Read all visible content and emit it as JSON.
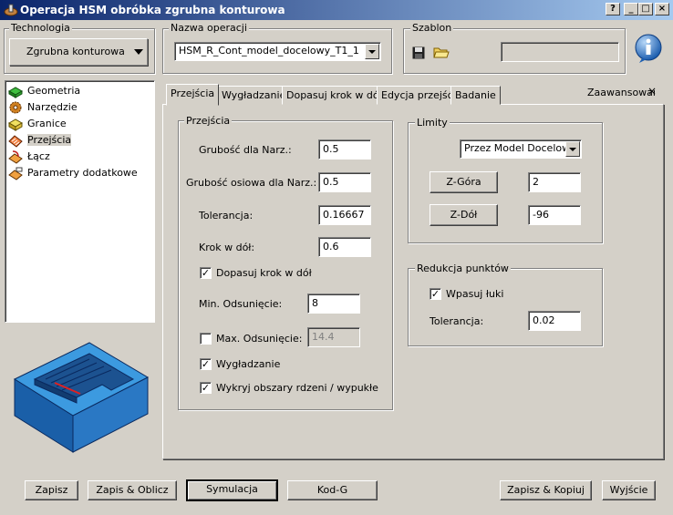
{
  "window": {
    "title": "Operacja HSM obróbka zgrubna konturowa",
    "controls": {
      "help": "?",
      "minimize": "_",
      "maximize": "□",
      "close": "×"
    }
  },
  "technologia": {
    "legend": "Technologia",
    "value": "Zgrubna konturowa"
  },
  "nazwa_operacji": {
    "legend": "Nazwa operacji",
    "value": "HSM_R_Cont_model_docelowy_T1_1"
  },
  "szablon": {
    "legend": "Szablon",
    "value": ""
  },
  "tree": {
    "items": [
      {
        "label": "Geometria",
        "icon": "geometry-icon"
      },
      {
        "label": "Narzędzie",
        "icon": "tool-icon"
      },
      {
        "label": "Granice",
        "icon": "boundary-icon"
      },
      {
        "label": "Przejścia",
        "icon": "passes-icon",
        "selected": true
      },
      {
        "label": "Łącz",
        "icon": "link-icon"
      },
      {
        "label": "Parametry dodatkowe",
        "icon": "parameters-icon"
      }
    ]
  },
  "tabs": {
    "items": [
      "Przejścia",
      "Wygładzanie",
      "Dopasuj krok w dół",
      "Edycja przejść",
      "Badanie"
    ],
    "active": 0,
    "advanced": "Zaawansowane"
  },
  "przejscia": {
    "legend": "Przejścia",
    "grubosc_label": "Grubość dla Narz.:",
    "grubosc_value": "0.5",
    "grubosc_osiowa_label": "Grubość osiowa dla Narz.:",
    "grubosc_osiowa_value": "0.5",
    "tolerancja_label": "Tolerancja:",
    "tolerancja_value": "0.16667",
    "krok_label": "Krok w dół:",
    "krok_value": "0.6",
    "dopasuj_label": "Dopasuj krok w dół",
    "dopasuj_checked": true,
    "min_odsuniecie_label": "Min. Odsunięcie:",
    "min_odsuniecie_value": "8",
    "max_odsuniecie_label": "Max. Odsunięcie:",
    "max_odsuniecie_value": "14.4",
    "max_odsuniecie_checked": false,
    "wygladzanie_label": "Wygładzanie",
    "wygladzanie_checked": true,
    "wykryj_label": "Wykryj obszary rdzeni / wypukłe",
    "wykryj_checked": true
  },
  "limity": {
    "legend": "Limity",
    "mode": "Przez Model Docelowy",
    "z_gora_label": "Z-Góra",
    "z_gora_value": "2",
    "z_dol_label": "Z-Dół",
    "z_dol_value": "-96"
  },
  "redukcja": {
    "legend": "Redukcja punktów",
    "wpasuj_label": "Wpasuj łuki",
    "wpasuj_checked": true,
    "tolerancja_label": "Tolerancja:",
    "tolerancja_value": "0.02"
  },
  "buttons": {
    "zapisz": "Zapisz",
    "zapis_oblicz": "Zapis & Oblicz",
    "symulacja": "Symulacja",
    "kod_g": "Kod-G",
    "zapisz_kopiuj": "Zapisz & Kopiuj",
    "wyjscie": "Wyjście"
  },
  "colors": {
    "titlebar": "#0a246a",
    "preview_blue": "#2f8fd0",
    "info_blue": "#2a6fc2"
  }
}
